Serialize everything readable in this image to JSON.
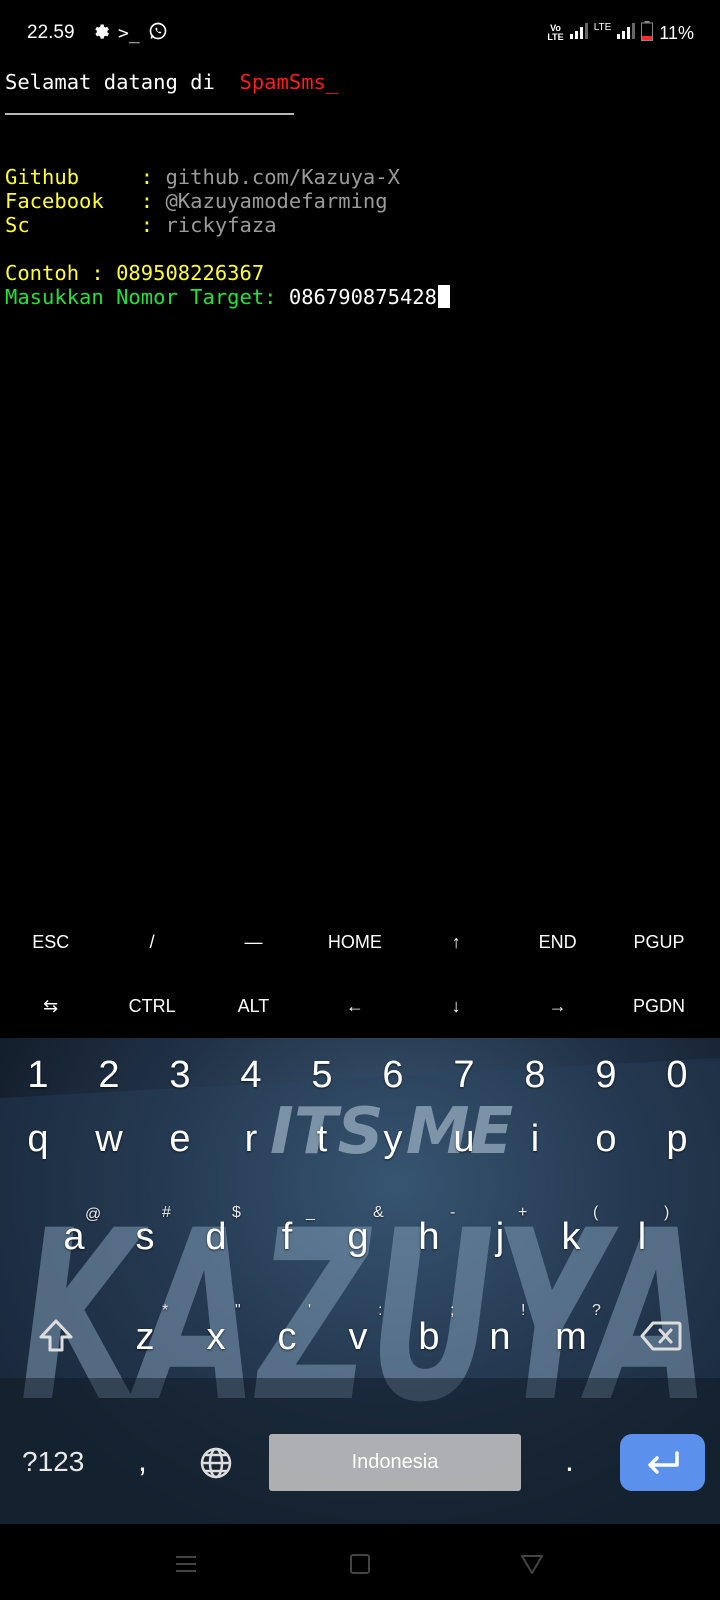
{
  "status_bar": {
    "time": "22.59",
    "icons_left": [
      "gear-icon",
      "terminal-icon",
      "whatsapp-icon"
    ],
    "icons_right": [
      "volte-icon",
      "signal-icon",
      "lte-icon",
      "signal-icon",
      "battery-low-icon"
    ],
    "battery_percent": "11%"
  },
  "terminal": {
    "welcome_prefix": "Selamat datang di  ",
    "welcome_app": "SpamSms_",
    "rows": [
      {
        "label": "Github     ",
        "sep": ": ",
        "value": "github.com/Kazuya-X"
      },
      {
        "label": "Facebook   ",
        "sep": ": ",
        "value": "@Kazuyamodefarming"
      },
      {
        "label": "Sc         ",
        "sep": ": ",
        "value": "rickyfaza"
      }
    ],
    "example_line": "Contoh : 089508226367",
    "prompt_label": "Masukkan Nomor Target: ",
    "prompt_value": "086790875428"
  },
  "extra_keys": {
    "row1": [
      "ESC",
      "/",
      "—",
      "HOME",
      "↑",
      "END",
      "PGUP"
    ],
    "row2": [
      "⇆",
      "CTRL",
      "ALT",
      "←",
      "↓",
      "→",
      "PGDN"
    ]
  },
  "keyboard": {
    "numbers": [
      "1",
      "2",
      "3",
      "4",
      "5",
      "6",
      "7",
      "8",
      "9",
      "0"
    ],
    "row_q": [
      "q",
      "w",
      "e",
      "r",
      "t",
      "y",
      "u",
      "i",
      "o",
      "p"
    ],
    "row_a": [
      "a",
      "s",
      "d",
      "f",
      "g",
      "h",
      "j",
      "k",
      "l"
    ],
    "row_a_hints": [
      "@",
      "#",
      "$",
      "_",
      "&",
      "-",
      "+",
      "(",
      ")"
    ],
    "row_z": [
      "z",
      "x",
      "c",
      "v",
      "b",
      "n",
      "m"
    ],
    "row_z_hints": [
      "*",
      "\"",
      "'",
      ":",
      ";",
      "!",
      "?"
    ],
    "symbols_label": "?123",
    "comma": ",",
    "space_label": "Indonesia",
    "period": ".",
    "accent": "#5b91ec",
    "art_text_top": "ITS ME",
    "art_text_main": "KAZUYA"
  },
  "nav_bar": {
    "icons": [
      "menu-icon",
      "home-square-icon",
      "back-triangle-icon"
    ]
  }
}
